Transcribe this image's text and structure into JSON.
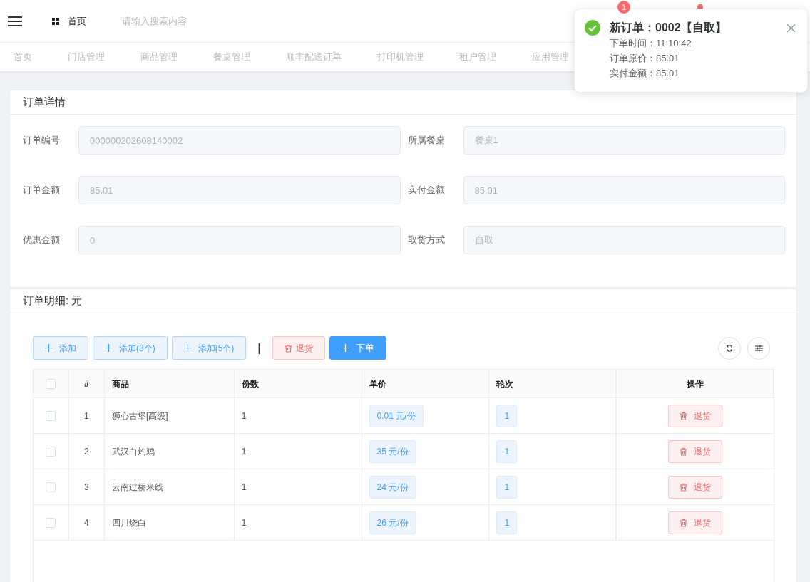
{
  "header": {
    "breadcrumb": "首页",
    "search": {
      "placeholder": "请输入搜索内容"
    },
    "badge": "1"
  },
  "tabs": [
    {
      "label": "首页",
      "selected": false
    },
    {
      "label": "门店管理",
      "selected": false
    },
    {
      "label": "商品管理",
      "selected": false
    },
    {
      "label": "餐桌管理",
      "selected": false
    },
    {
      "label": "顺丰配送订单",
      "selected": false
    },
    {
      "label": "打印机管理",
      "selected": false
    },
    {
      "label": "租户管理",
      "selected": false
    },
    {
      "label": "应用管理",
      "selected": false
    }
  ],
  "order_detail": {
    "title": "订单详情",
    "fields": [
      {
        "label": "订单编号",
        "value": "000000202608140002"
      },
      {
        "label": "所属餐桌",
        "value": "餐桌1"
      },
      {
        "label": "订单金额",
        "value": "85.01"
      },
      {
        "label": "实付金额",
        "value": "85.01"
      },
      {
        "label": "优惠金额",
        "value": "0"
      },
      {
        "label": "取货方式",
        "value": "自取"
      }
    ]
  },
  "items": {
    "title": "订单明细: 元",
    "toolbar": [
      {
        "label": "添加",
        "kind": "add"
      },
      {
        "label": "添加(3个)",
        "kind": "add"
      },
      {
        "label": "添加(5个)",
        "kind": "add"
      },
      {
        "label": "|",
        "kind": "separator"
      },
      {
        "label": "退货",
        "kind": "return"
      },
      {
        "label": "下单",
        "kind": "primary"
      }
    ],
    "table": {
      "select_all_checked": false,
      "columns": [
        "#",
        "商品",
        "份数",
        "单价",
        "轮次",
        "操作"
      ],
      "rows": [
        {
          "checked": false,
          "index": "1",
          "product": "狮心古堡[高级]",
          "quantity": "1",
          "price": "0.01 元/份",
          "round": "1",
          "action": "退货"
        },
        {
          "checked": false,
          "index": "2",
          "product": "武汉白灼鸡",
          "quantity": "1",
          "price": "35 元/份",
          "round": "1",
          "action": "退货"
        },
        {
          "checked": false,
          "index": "3",
          "product": "云南过桥米线",
          "quantity": "1",
          "price": "24 元/份",
          "round": "1",
          "action": "退货"
        },
        {
          "checked": false,
          "index": "4",
          "product": "四川烧白",
          "quantity": "1",
          "price": "26 元/份",
          "round": "1",
          "action": "退货"
        }
      ]
    }
  },
  "notification": {
    "title": "新订单：0002【自取】",
    "lines": [
      "下单时间：11:10:42",
      "订单原价：85.01",
      "实付金额：85.01"
    ]
  }
}
